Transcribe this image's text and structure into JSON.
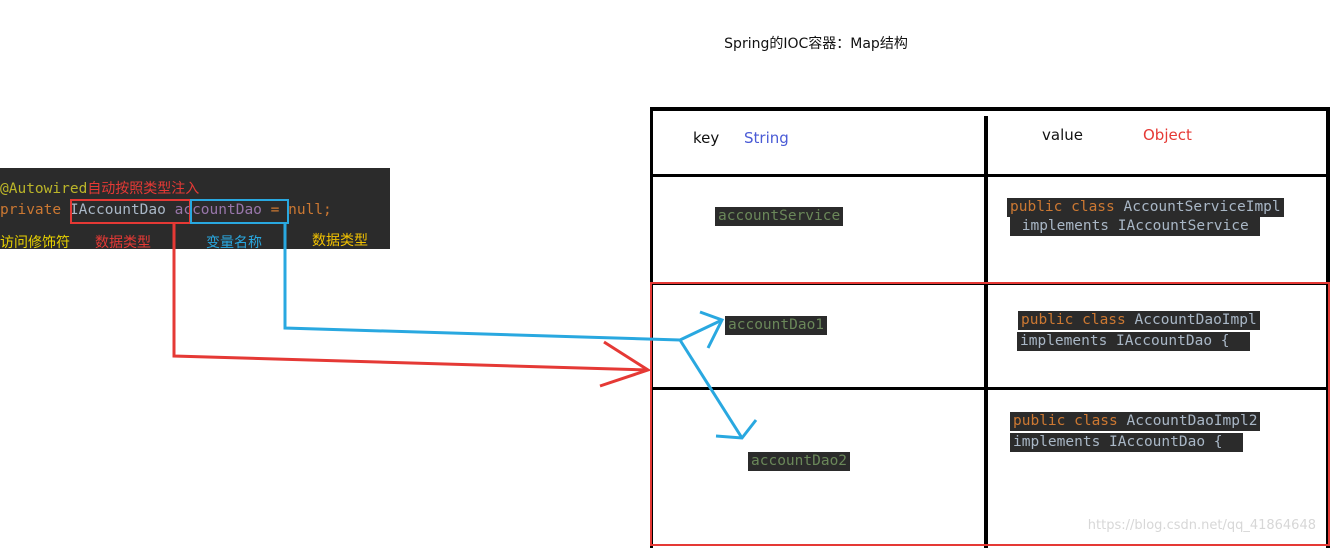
{
  "title": "Spring的IOC容器：Map结构",
  "code": {
    "annotation": "@Autowired",
    "annotation_note": "自动按照类型注入",
    "modifier": "private",
    "type": "IAccountDao",
    "var_name": "accountDao",
    "rest": " = null;",
    "labels": [
      "访问修饰符",
      "数据类型",
      "变量名称",
      "数据类型"
    ]
  },
  "table": {
    "key_header": "key",
    "key_type": "String",
    "value_header": "value",
    "value_type": "Object",
    "rows": [
      {
        "key": "accountService",
        "value_line1": [
          {
            "t": "public class ",
            "c": "kw"
          },
          {
            "t": "AccountServiceImpl",
            "c": "ident"
          }
        ],
        "value_line2": [
          {
            "t": " implements IAccountService ",
            "c": "ident"
          }
        ]
      },
      {
        "key": "accountDao1",
        "value_line1": [
          {
            "t": "public class ",
            "c": "kw"
          },
          {
            "t": "AccountDaoImpl",
            "c": "ident"
          }
        ],
        "value_line2": [
          {
            "t": "implements IAccountDao {  ",
            "c": "ident"
          }
        ]
      },
      {
        "key": "accountDao2",
        "value_line1": [
          {
            "t": "public class ",
            "c": "kw"
          },
          {
            "t": "AccountDaoImpl2",
            "c": "ident"
          }
        ],
        "value_line2": [
          {
            "t": "implements IAccountDao {  ",
            "c": "ident"
          }
        ]
      }
    ]
  },
  "watermark": "https://blog.csdn.net/qq_41864648",
  "colors": {
    "red": "#e53935",
    "blue": "#29a8e0",
    "black": "#000000",
    "code_bg": "#2b2b2b"
  }
}
